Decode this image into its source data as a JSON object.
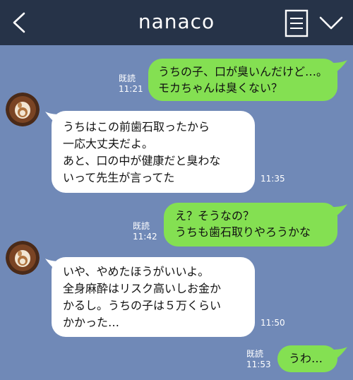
{
  "header": {
    "title": "nanaco"
  },
  "messages": [
    {
      "side": "sent",
      "lines": [
        "うちの子、口が臭いんだけど…。",
        "モカちゃんは臭くない？"
      ],
      "read": "既読",
      "time": "11:21"
    },
    {
      "side": "recv",
      "lines": [
        "うちはこの前歯石取ったから",
        "一応大丈夫だよ。",
        "あと、口の中が健康だと臭わな",
        "いって先生が言ってた"
      ],
      "time": "11:35"
    },
    {
      "side": "sent",
      "lines": [
        "え？そうなの？",
        "うちも歯石取りやろうかな"
      ],
      "read": "既読",
      "time": "11:42"
    },
    {
      "side": "recv",
      "lines": [
        "いや、やめたほうがいいよ。",
        "全身麻酔はリスク高いしお金か",
        "かるし。うちの子は５万くらい",
        "かかった…"
      ],
      "time": "11:50"
    },
    {
      "side": "sent",
      "lines": [
        "うわ…"
      ],
      "read": "既読",
      "time": "11:53"
    }
  ],
  "colors": {
    "header": "#263348",
    "background": "#7089b7",
    "sent_bubble": "#84e052",
    "recv_bubble": "#ffffff"
  },
  "icons": {
    "back": "chevron-left-icon",
    "memo": "note-icon",
    "menu": "chevron-down-icon",
    "avatar": "latte-art-avatar"
  }
}
